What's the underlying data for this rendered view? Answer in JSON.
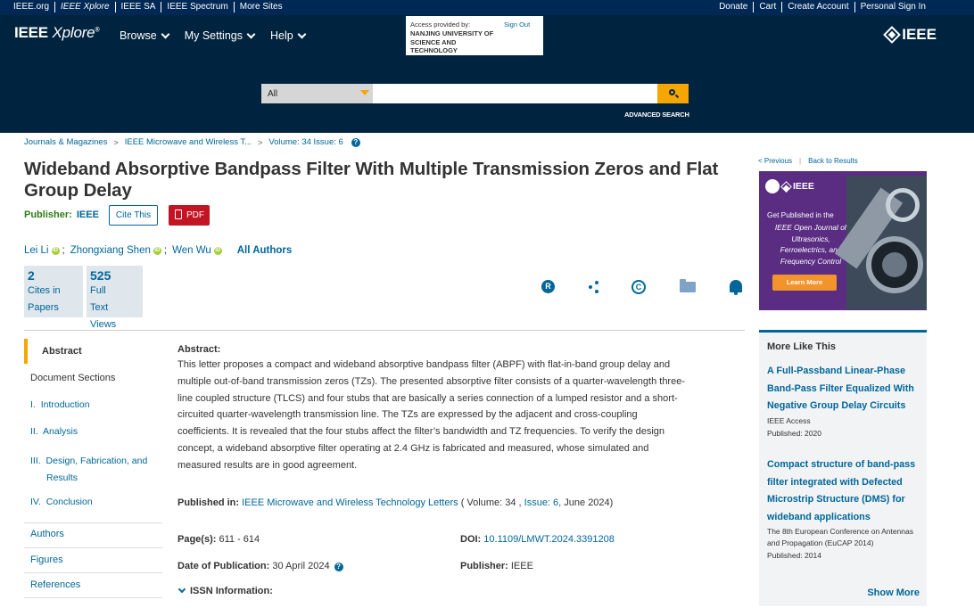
{
  "topbar": {
    "left_links": [
      "IEEE.org",
      "IEEE Xplore",
      "IEEE SA",
      "IEEE Spectrum",
      "More Sites"
    ],
    "right_links": [
      "Donate",
      "Cart",
      "Create Account",
      "Personal Sign In"
    ]
  },
  "header": {
    "brand_ieee": "IEEE",
    "brand_xplore": "Xplore",
    "brand_reg": "®",
    "nav": [
      "Browse",
      "My Settings",
      "Help"
    ],
    "access_label": "Access provided by:",
    "access_org": "NANJING UNIVERSITY OF SCIENCE AND TECHNOLOGY",
    "sign_out": "Sign Out",
    "ieee_logo": "IEEE"
  },
  "search": {
    "scope_selected": "All",
    "query": "",
    "advanced": "ADVANCED SEARCH"
  },
  "breadcrumb": [
    "Journals & Magazines",
    "IEEE Microwave and Wireless T...",
    "Volume: 34 Issue: 6"
  ],
  "article": {
    "title": "Wideband Absorptive Bandpass Filter With Multiple Transmission Zeros and Flat Group Delay",
    "publisher_label": "Publisher:",
    "publisher_value": "IEEE",
    "cite_this": "Cite This",
    "pdf": "PDF",
    "authors": [
      "Lei Li",
      "Zhongxiang Shen",
      "Wen Wu"
    ],
    "all_authors": "All Authors",
    "cites_count": "2",
    "cites_label_1": "Cites in",
    "cites_label_2": "Papers",
    "views_count": "525",
    "views_label_1": "Full",
    "views_label_2": "Text",
    "views_label_3": "Views"
  },
  "docnav": {
    "abstract": "Abstract",
    "sections": "Document Sections",
    "items": [
      {
        "num": "I.",
        "label": "Introduction"
      },
      {
        "num": "II.",
        "label": "Analysis"
      },
      {
        "num": "III.",
        "label": "Design, Fabrication, and"
      },
      {
        "num": "IV.",
        "label": "Conclusion"
      }
    ],
    "item3_cont": "Results",
    "authors": "Authors",
    "figures": "Figures",
    "references": "References"
  },
  "abstract": {
    "heading": "Abstract:",
    "lines": [
      "This letter proposes a compact and wideband absorptive bandpass filter (ABPF) with flat-in-band group delay and",
      "multiple out-of-band transmission zeros (TZs). The presented absorptive filter consists of a quarter-wavelength three-",
      "line coupled structure (TLCS) and four stubs that are basically a series connection of a lumped resistor and a short-",
      "circuited quarter-wavelength transmission line. The TZs are expressed by the adjacent and cross-coupling",
      "coefficients. It is revealed that the four stubs affect the filter’s bandwidth and TZ frequencies. To verify the design",
      "concept, a wideband absorptive filter operating at 2.4 GHz is fabricated and measured, whose simulated and",
      "measured results are in good agreement."
    ]
  },
  "details": {
    "pubin_label": "Published in:",
    "pubin_journal": "IEEE Microwave and Wireless Technology Letters",
    "pubin_vol": "( Volume: 34 ,",
    "pubin_issue": "Issue: 6,",
    "pubin_date": "June 2024)",
    "pages_label": "Page(s):",
    "pages_value": "611 - 614",
    "doi_label": "DOI:",
    "doi_value": "10.1109/LMWT.2024.3391208",
    "date_label": "Date of Publication:",
    "date_value": "30 April 2024",
    "publisher_label": "Publisher:",
    "publisher_value": "IEEE",
    "issn": "ISSN Information:"
  },
  "sidebar": {
    "previous": "< Previous",
    "back": "Back to Results",
    "ad_logo": "IEEE",
    "ad_line1": "Get Published in the",
    "ad_line2": "IEEE Open Journal of Ultrasonics, Ferroelectrics, and Frequency Control",
    "ad_button": "Learn More",
    "more_like_heading": "More Like This",
    "more_like": [
      {
        "title": "A Full-Passband Linear-Phase Band-Pass Filter Equalized With Negative Group Delay Circuits",
        "source": "IEEE Access",
        "published": "Published: 2020"
      },
      {
        "title": "Compact structure of band-pass filter integrated with Defected Microstrip Structure (DMS) for wideband applications",
        "source": "The 8th European Conference on Antennas and Propagation (EuCAP 2014)",
        "published": "Published: 2014"
      }
    ],
    "show_more": "Show More"
  }
}
